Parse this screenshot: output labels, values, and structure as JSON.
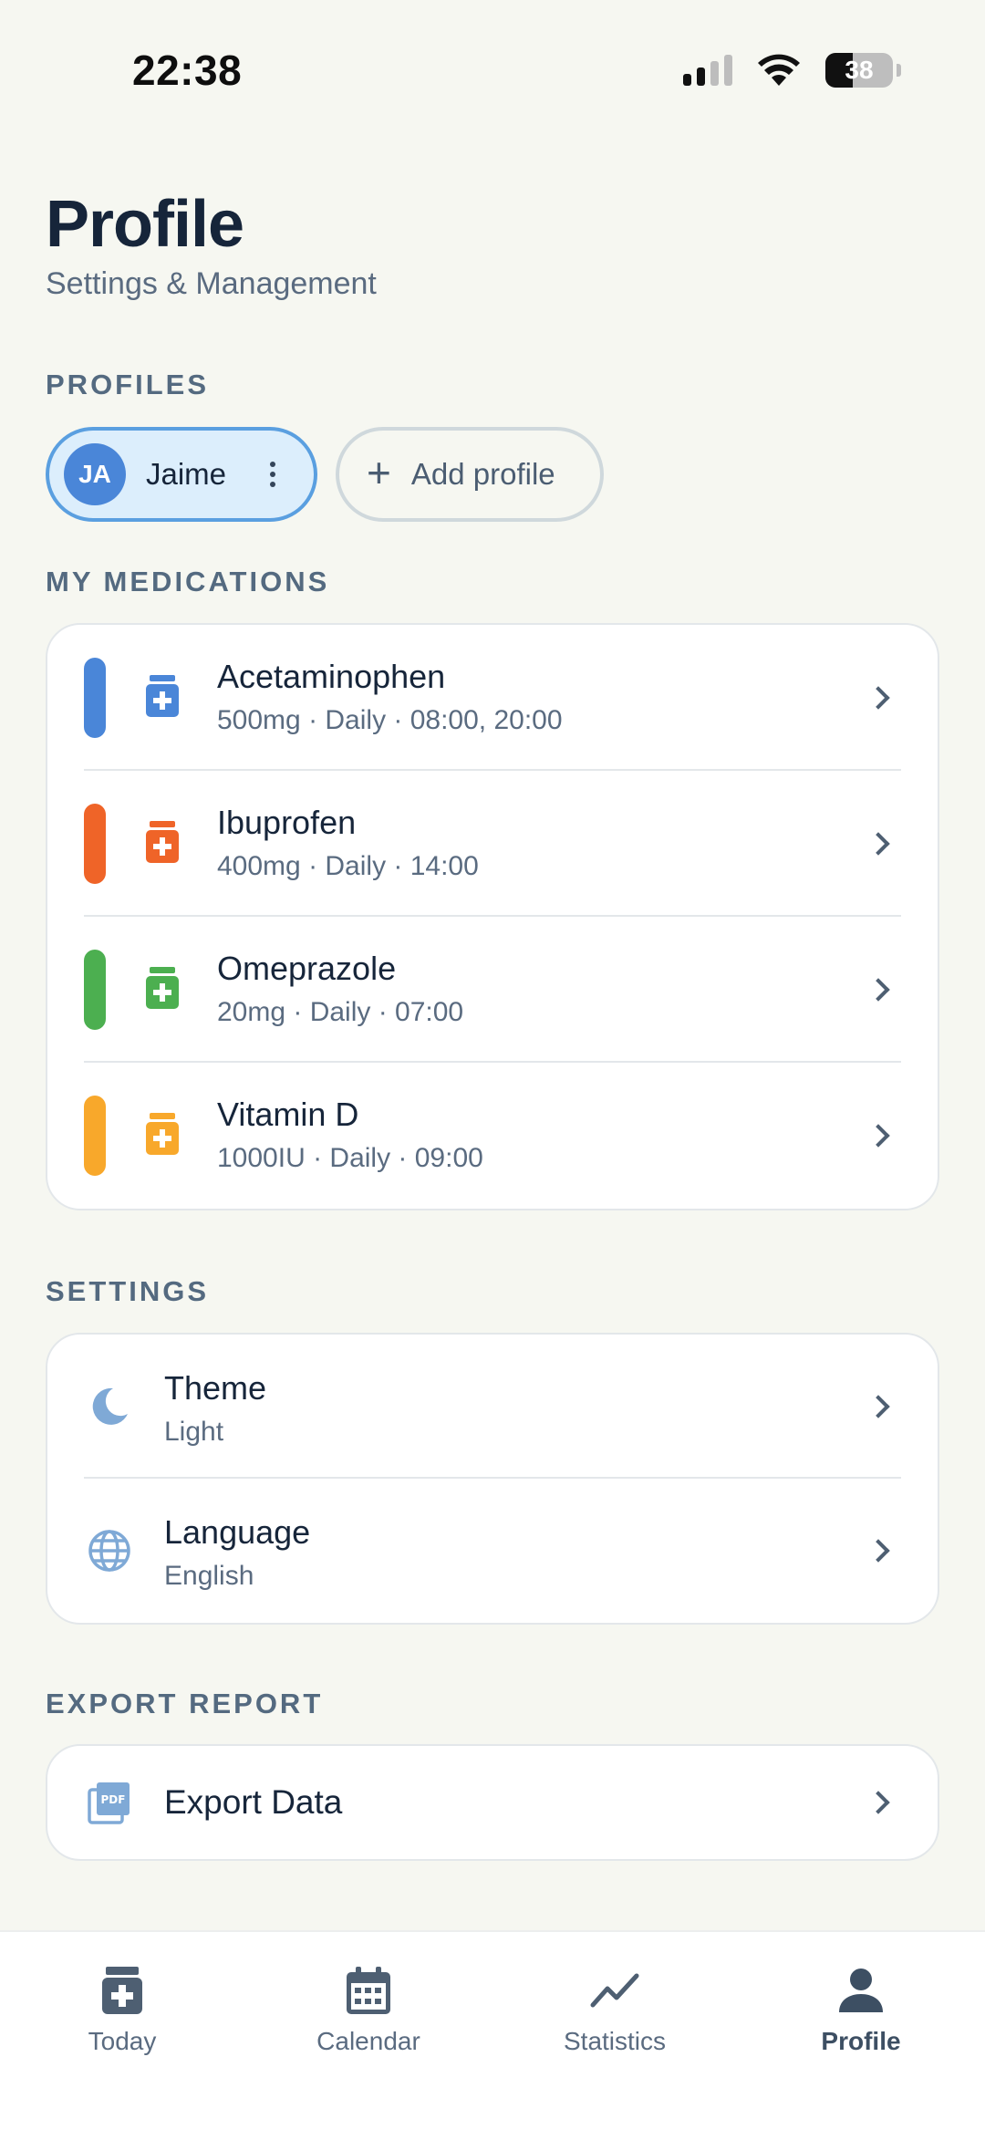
{
  "status_bar": {
    "time": "22:38",
    "battery": "38"
  },
  "header": {
    "title": "Profile",
    "subtitle": "Settings & Management"
  },
  "profiles": {
    "section_label": "PROFILES",
    "active": {
      "initials": "JA",
      "name": "Jaime"
    },
    "add_label": "Add profile"
  },
  "medications": {
    "section_label": "MY MEDICATIONS",
    "items": [
      {
        "name": "Acetaminophen",
        "detail": "500mg · Daily · 08:00, 20:00",
        "color": "#4A86D8"
      },
      {
        "name": "Ibuprofen",
        "detail": "400mg · Daily · 14:00",
        "color": "#EF6428"
      },
      {
        "name": "Omeprazole",
        "detail": "20mg · Daily · 07:00",
        "color": "#4CAF50"
      },
      {
        "name": "Vitamin D",
        "detail": "1000IU · Daily · 09:00",
        "color": "#F8A82B"
      }
    ]
  },
  "settings": {
    "section_label": "SETTINGS",
    "theme": {
      "title": "Theme",
      "value": "Light",
      "icon": "moon-icon"
    },
    "language": {
      "title": "Language",
      "value": "English",
      "icon": "globe-icon"
    }
  },
  "export": {
    "section_label": "EXPORT REPORT",
    "title": "Export Data",
    "icon_text": "PDF"
  },
  "nav": {
    "items": [
      {
        "label": "Today",
        "icon": "medication-icon"
      },
      {
        "label": "Calendar",
        "icon": "calendar-icon"
      },
      {
        "label": "Statistics",
        "icon": "trend-icon"
      },
      {
        "label": "Profile",
        "icon": "person-icon",
        "active": true
      }
    ]
  },
  "colors": {
    "accent": "#4A86D8",
    "background": "#F6F7F1",
    "text": "#16253A"
  }
}
